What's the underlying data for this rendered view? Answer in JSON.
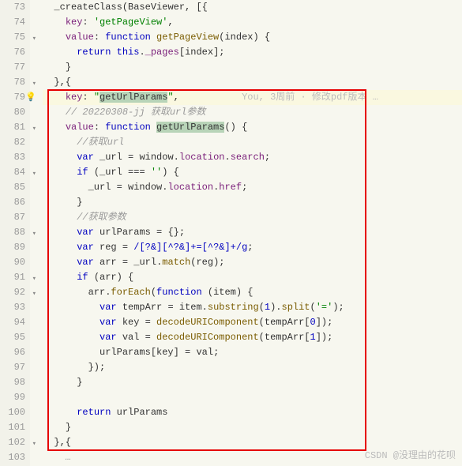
{
  "lineStart": 73,
  "lineEnd": 103,
  "foldLines": [
    75,
    78,
    81,
    84,
    88,
    91,
    92,
    102
  ],
  "bulbLine": 79,
  "highlightedLine": 79,
  "blame": "You, 3周前 · 修改pdf版本 …",
  "watermark": "CSDN @没理由的花呗",
  "code": {
    "l73": {
      "indent": "  ",
      "tokens": [
        [
          "id",
          "_createClass"
        ],
        [
          "id",
          "("
        ],
        [
          "id",
          "BaseViewer"
        ],
        [
          "id",
          ", [{"
        ]
      ]
    },
    "l74": {
      "indent": "    ",
      "tokens": [
        [
          "prop",
          "key"
        ],
        [
          "id",
          ": "
        ],
        [
          "str",
          "'getPageView'"
        ],
        [
          "id",
          ","
        ]
      ]
    },
    "l75": {
      "indent": "    ",
      "tokens": [
        [
          "prop",
          "value"
        ],
        [
          "id",
          ": "
        ],
        [
          "kw",
          "function"
        ],
        [
          "id",
          " "
        ],
        [
          "fn",
          "getPageView"
        ],
        [
          "id",
          "("
        ],
        [
          "id",
          "index"
        ],
        [
          "id",
          ") {"
        ]
      ]
    },
    "l76": {
      "indent": "      ",
      "tokens": [
        [
          "kw",
          "return"
        ],
        [
          "id",
          " "
        ],
        [
          "kw",
          "this"
        ],
        [
          "id",
          "."
        ],
        [
          "prop",
          "_pages"
        ],
        [
          "id",
          "["
        ],
        [
          "id",
          "index"
        ],
        [
          "id",
          "];"
        ]
      ]
    },
    "l77": {
      "indent": "    ",
      "tokens": [
        [
          "id",
          "}"
        ]
      ]
    },
    "l78": {
      "indent": "  ",
      "tokens": [
        [
          "id",
          "},{"
        ]
      ]
    },
    "l79": {
      "indent": "    ",
      "tokens": [
        [
          "prop",
          "key"
        ],
        [
          "id",
          ": "
        ],
        [
          "str",
          "\""
        ],
        [
          "sel",
          "getUrlParams"
        ],
        [
          "str",
          "\""
        ],
        [
          "id",
          ","
        ],
        [
          "blame",
          "           You, 3周前 · 修改pdf版本 …"
        ]
      ]
    },
    "l80": {
      "indent": "    ",
      "tokens": [
        [
          "com",
          "// 20220308-jj 获取url参数"
        ]
      ]
    },
    "l81": {
      "indent": "    ",
      "tokens": [
        [
          "prop",
          "value"
        ],
        [
          "id",
          ": "
        ],
        [
          "kw",
          "function"
        ],
        [
          "id",
          " "
        ],
        [
          "sel",
          "getUrlParams"
        ],
        [
          "id",
          "() {"
        ]
      ]
    },
    "l82": {
      "indent": "      ",
      "tokens": [
        [
          "com",
          "//获取url"
        ]
      ]
    },
    "l83": {
      "indent": "      ",
      "tokens": [
        [
          "kw",
          "var"
        ],
        [
          "id",
          " "
        ],
        [
          "id",
          "_url"
        ],
        [
          "id",
          " = "
        ],
        [
          "id",
          "window"
        ],
        [
          "id",
          "."
        ],
        [
          "prop",
          "location"
        ],
        [
          "id",
          "."
        ],
        [
          "prop",
          "search"
        ],
        [
          "id",
          ";"
        ]
      ]
    },
    "l84": {
      "indent": "      ",
      "tokens": [
        [
          "kw",
          "if"
        ],
        [
          "id",
          " ("
        ],
        [
          "id",
          "_url"
        ],
        [
          "id",
          " === "
        ],
        [
          "str",
          "''"
        ],
        [
          "id",
          ") {"
        ]
      ]
    },
    "l85": {
      "indent": "        ",
      "tokens": [
        [
          "id",
          "_url"
        ],
        [
          "id",
          " = "
        ],
        [
          "id",
          "window"
        ],
        [
          "id",
          "."
        ],
        [
          "prop",
          "location"
        ],
        [
          "id",
          "."
        ],
        [
          "prop",
          "href"
        ],
        [
          "id",
          ";"
        ]
      ]
    },
    "l86": {
      "indent": "      ",
      "tokens": [
        [
          "id",
          "}"
        ]
      ]
    },
    "l87": {
      "indent": "      ",
      "tokens": [
        [
          "com",
          "//获取参数"
        ]
      ]
    },
    "l88": {
      "indent": "      ",
      "tokens": [
        [
          "kw",
          "var"
        ],
        [
          "id",
          " "
        ],
        [
          "id",
          "urlParams"
        ],
        [
          "id",
          " = {};"
        ]
      ]
    },
    "l89": {
      "indent": "      ",
      "tokens": [
        [
          "kw",
          "var"
        ],
        [
          "id",
          " "
        ],
        [
          "id",
          "reg"
        ],
        [
          "id",
          " = "
        ],
        [
          "regex",
          "/[?&][^?&]+=[^?&]+/g"
        ],
        [
          "id",
          ";"
        ]
      ]
    },
    "l90": {
      "indent": "      ",
      "tokens": [
        [
          "kw",
          "var"
        ],
        [
          "id",
          " "
        ],
        [
          "id",
          "arr"
        ],
        [
          "id",
          " = "
        ],
        [
          "id",
          "_url"
        ],
        [
          "id",
          "."
        ],
        [
          "fn",
          "match"
        ],
        [
          "id",
          "("
        ],
        [
          "id",
          "reg"
        ],
        [
          "id",
          ");"
        ]
      ]
    },
    "l91": {
      "indent": "      ",
      "tokens": [
        [
          "kw",
          "if"
        ],
        [
          "id",
          " ("
        ],
        [
          "id",
          "arr"
        ],
        [
          "id",
          ") {"
        ]
      ]
    },
    "l92": {
      "indent": "        ",
      "tokens": [
        [
          "id",
          "arr"
        ],
        [
          "id",
          "."
        ],
        [
          "fn",
          "forEach"
        ],
        [
          "id",
          "("
        ],
        [
          "kw",
          "function"
        ],
        [
          "id",
          " ("
        ],
        [
          "id",
          "item"
        ],
        [
          "id",
          ") {"
        ]
      ]
    },
    "l93": {
      "indent": "          ",
      "tokens": [
        [
          "kw",
          "var"
        ],
        [
          "id",
          " "
        ],
        [
          "id",
          "tempArr"
        ],
        [
          "id",
          " = "
        ],
        [
          "id",
          "item"
        ],
        [
          "id",
          "."
        ],
        [
          "fn",
          "substring"
        ],
        [
          "id",
          "("
        ],
        [
          "num",
          "1"
        ],
        [
          "id",
          ")."
        ],
        [
          "fn",
          "split"
        ],
        [
          "id",
          "("
        ],
        [
          "str",
          "'='"
        ],
        [
          "id",
          ");"
        ]
      ]
    },
    "l94": {
      "indent": "          ",
      "tokens": [
        [
          "kw",
          "var"
        ],
        [
          "id",
          " "
        ],
        [
          "id",
          "key"
        ],
        [
          "id",
          " = "
        ],
        [
          "fn",
          "decodeURIComponent"
        ],
        [
          "id",
          "("
        ],
        [
          "id",
          "tempArr"
        ],
        [
          "id",
          "["
        ],
        [
          "num",
          "0"
        ],
        [
          "id",
          "]);"
        ]
      ]
    },
    "l95": {
      "indent": "          ",
      "tokens": [
        [
          "kw",
          "var"
        ],
        [
          "id",
          " "
        ],
        [
          "id",
          "val"
        ],
        [
          "id",
          " = "
        ],
        [
          "fn",
          "decodeURIComponent"
        ],
        [
          "id",
          "("
        ],
        [
          "id",
          "tempArr"
        ],
        [
          "id",
          "["
        ],
        [
          "num",
          "1"
        ],
        [
          "id",
          "]);"
        ]
      ]
    },
    "l96": {
      "indent": "          ",
      "tokens": [
        [
          "id",
          "urlParams"
        ],
        [
          "id",
          "["
        ],
        [
          "id",
          "key"
        ],
        [
          "id",
          "] = "
        ],
        [
          "id",
          "val"
        ],
        [
          "id",
          ";"
        ]
      ]
    },
    "l97": {
      "indent": "        ",
      "tokens": [
        [
          "id",
          "});"
        ]
      ]
    },
    "l98": {
      "indent": "      ",
      "tokens": [
        [
          "id",
          "}"
        ]
      ]
    },
    "l99": {
      "indent": "",
      "tokens": []
    },
    "l100": {
      "indent": "      ",
      "tokens": [
        [
          "kw",
          "return"
        ],
        [
          "id",
          " "
        ],
        [
          "id",
          "urlParams"
        ]
      ]
    },
    "l101": {
      "indent": "    ",
      "tokens": [
        [
          "id",
          "}"
        ]
      ]
    },
    "l102": {
      "indent": "  ",
      "tokens": [
        [
          "id",
          "},{"
        ]
      ]
    },
    "l103": {
      "indent": "    ",
      "tokens": [
        [
          "com",
          "…"
        ]
      ]
    }
  }
}
